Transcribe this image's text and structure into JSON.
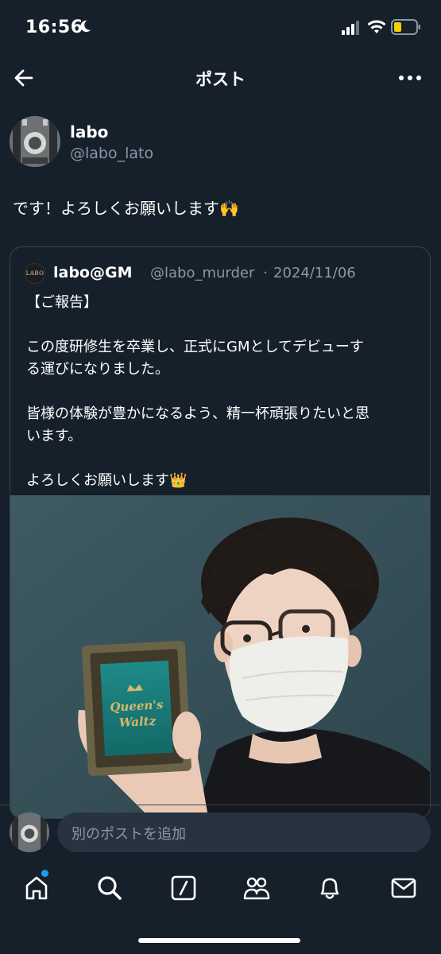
{
  "status_bar": {
    "time": "16:56",
    "icons": [
      "moon-icon",
      "signal-icon",
      "wifi-icon",
      "battery-icon"
    ]
  },
  "header": {
    "title": "ポスト",
    "back_icon": "back-arrow-icon",
    "more_icon": "more-icon"
  },
  "post": {
    "author_name": "labo",
    "author_handle": "@labo_lato",
    "text": "です！よろしくお願いします🙌"
  },
  "quote": {
    "avatar_text": "LABO",
    "name": "labo@GM",
    "handle": "@labo_murder",
    "separator": "·",
    "date": "2024/11/06",
    "lines": [
      "【ご報告】",
      "",
      "この度研修生を卒業し、正式にGMとしてデビューす",
      "る運びになりました。",
      "",
      "皆様の体験が豊かになるよう、精一杯頑張りたいと思",
      "います。",
      "",
      "よろしくお願いします👑"
    ],
    "photo": {
      "frame_text_line1": "Queen's",
      "frame_text_line2": "Waltz"
    }
  },
  "reply": {
    "placeholder": "別のポストを追加"
  },
  "tabbar": {
    "items": [
      "home-icon",
      "search-icon",
      "grok-icon",
      "communities-icon",
      "notifications-icon",
      "messages-icon"
    ]
  },
  "colors": {
    "background": "#15202b",
    "text_secondary": "#8b98a5",
    "border": "#38444d",
    "accent": "#1d9bf0",
    "input_bg": "#273340"
  }
}
